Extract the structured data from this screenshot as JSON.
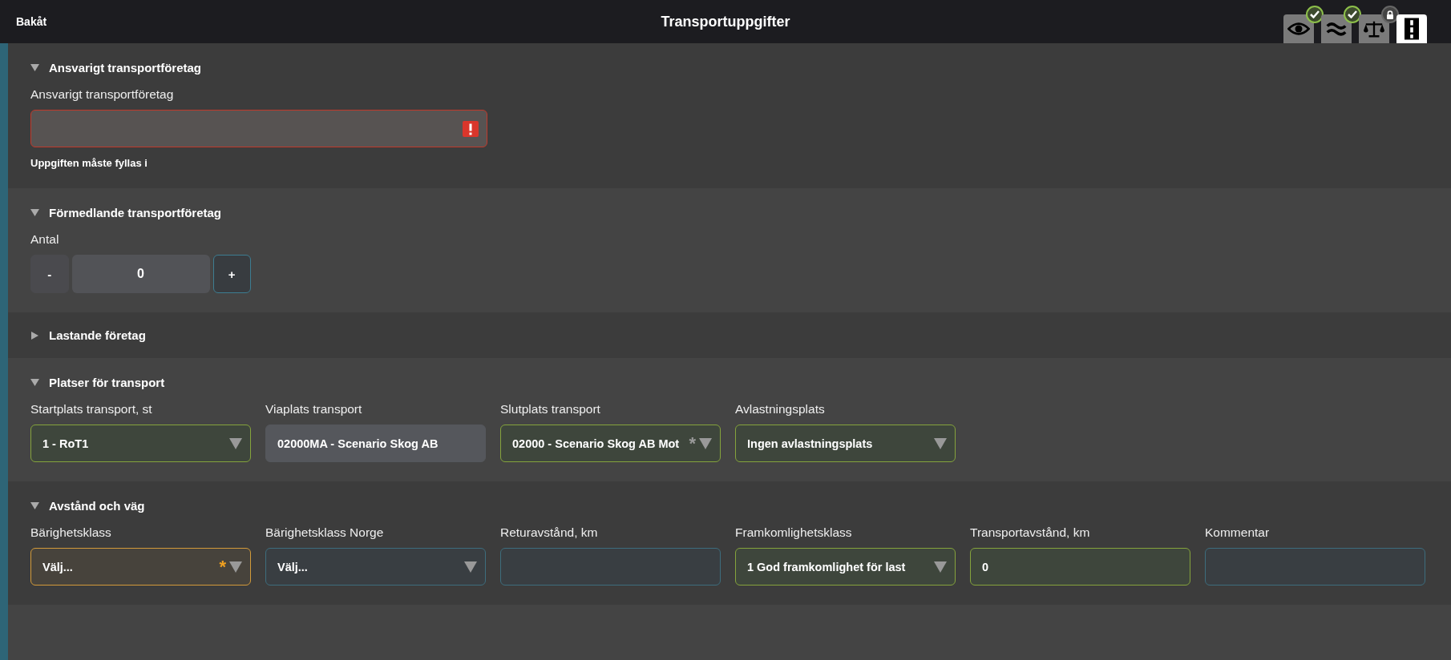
{
  "top_bar": {
    "back": "Bakåt",
    "title": "Transportuppgifter",
    "status_icons": [
      {
        "kind": "eye",
        "badge": {
          "kind": "check"
        },
        "selected": false
      },
      {
        "kind": "wave",
        "badge": {
          "kind": "check"
        },
        "selected": false
      },
      {
        "kind": "scale",
        "badge": {
          "kind": "lock"
        },
        "selected": false
      },
      {
        "kind": "road",
        "selected": true
      }
    ]
  },
  "sections": [
    {
      "title": "Ansvarigt transportföretag",
      "expanded": true,
      "kind": "single",
      "fields": [
        {
          "label": "Ansvarigt transportföretag",
          "dropdown": false,
          "kind": "error",
          "error_message": "Uppgiften måste fyllas i"
        }
      ]
    },
    {
      "title": "Förmedlande transportföretag",
      "expanded": true,
      "kind": "stepper",
      "stepper": {
        "label": "Antal",
        "minus": "-",
        "value": "0",
        "plus": "+"
      }
    },
    {
      "title": "Lastande företag",
      "expanded": false
    },
    {
      "title": "Platser för transport",
      "expanded": true,
      "kind": "grid",
      "fields": [
        {
          "label": "Startplats transport, st",
          "dropdown": true,
          "kind": "valid",
          "value": "1 - RoT1"
        },
        {
          "label": "Viaplats transport",
          "dropdown": false,
          "kind": "readonly",
          "value": "02000MA - Scenario Skog AB"
        },
        {
          "label": "Slutplats transport",
          "dropdown": true,
          "kind": "valid",
          "value": "02000 - Scenario Skog AB Mot",
          "asterisk": "*"
        },
        {
          "label": "Avlastningsplats",
          "dropdown": true,
          "kind": "valid",
          "value": "Ingen avlastningsplats"
        }
      ]
    },
    {
      "title": "Avstånd och väg",
      "expanded": true,
      "kind": "grid",
      "fields": [
        {
          "label": "Bärighetsklass",
          "dropdown": true,
          "kind": "required",
          "value": "Välj...",
          "asterisk": "*"
        },
        {
          "label": "Bärighetsklass Norge",
          "dropdown": true,
          "kind": "neutral",
          "value": "Välj..."
        },
        {
          "label": "Returavstånd, km",
          "dropdown": false,
          "kind": "neutral"
        },
        {
          "label": "Framkomlighetsklass",
          "dropdown": true,
          "kind": "valid",
          "value": "1 God framkomlighet för last"
        },
        {
          "label": "Transportavstånd, km",
          "dropdown": false,
          "kind": "valid",
          "value": "0"
        },
        {
          "label": "Kommentar",
          "dropdown": false,
          "kind": "neutral"
        }
      ]
    }
  ]
}
